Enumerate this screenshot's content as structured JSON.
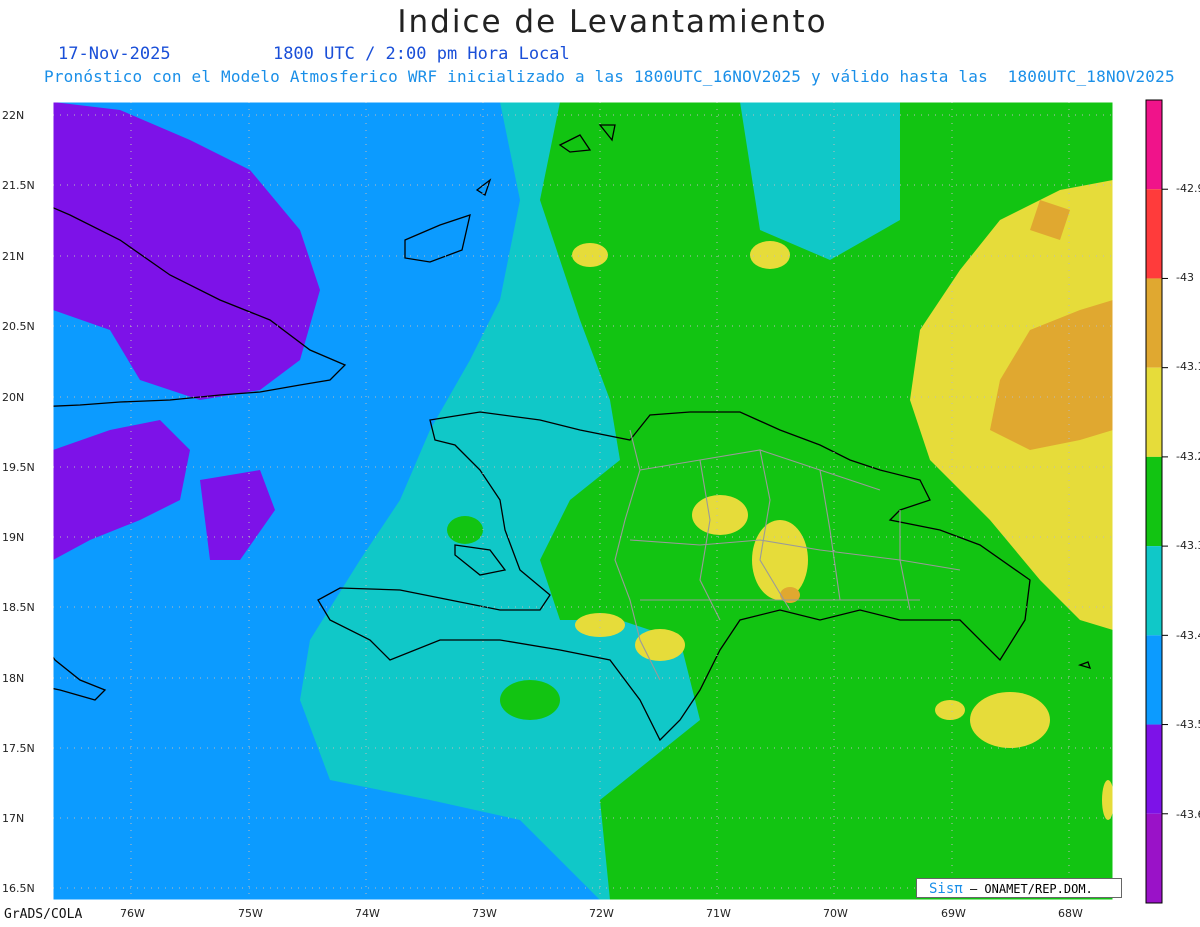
{
  "header": {
    "title": "Indice de Levantamiento",
    "date_label": "17-Nov-2025",
    "time_label": "1800 UTC / 2:00 pm Hora Local",
    "description": "Pronóstico con el Modelo Atmosferico WRF inicializado a las 1800UTC_16NOV2025 y válido hasta las  1800UTC_18NOV2025"
  },
  "map": {
    "lat_labels": [
      "22N",
      "21.5N",
      "21N",
      "20.5N",
      "20N",
      "19.5N",
      "19N",
      "18.5N",
      "18N",
      "17.5N",
      "17N",
      "16.5N"
    ],
    "lon_labels": [
      "76W",
      "75W",
      "74W",
      "73W",
      "72W",
      "71W",
      "70W",
      "69W",
      "68W"
    ],
    "extent": {
      "west": -76.65,
      "east": -67.6,
      "south": 16.45,
      "north": 22.1
    }
  },
  "colorbar": {
    "labels": [
      "-42.9",
      "-43",
      "-43.1",
      "-43.2",
      "-43.3",
      "-43.4",
      "-43.5",
      "-43.6"
    ],
    "colors": [
      "#f0138a",
      "#ff3b3b",
      "#e0a830",
      "#e6dc3a",
      "#12c412",
      "#10c8c8",
      "#0c9bff",
      "#7d12e8",
      "#9a12c8"
    ]
  },
  "footer": {
    "credit": "GrADS/COLA",
    "logo_text": "Sisπ",
    "source": "– ONAMET/REP.DOM."
  }
}
